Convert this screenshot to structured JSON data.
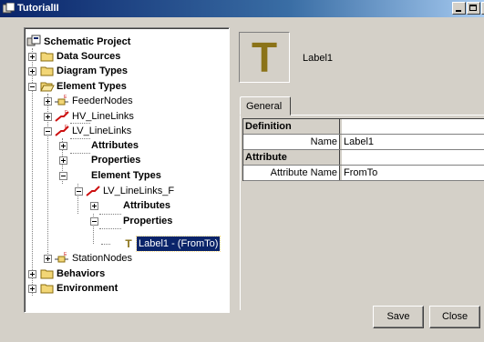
{
  "window": {
    "title": "TutorialII"
  },
  "tree": {
    "root": "Schematic Project",
    "data_sources": "Data Sources",
    "diagram_types": "Diagram Types",
    "element_types": "Element Types",
    "feeder_nodes": "FeederNodes",
    "hv_linelinks": "HV_LineLinks",
    "lv_linelinks": "LV_LineLinks",
    "attributes": "Attributes",
    "properties": "Properties",
    "element_types_nested": "Element Types",
    "lv_linelinks_f": "LV_LineLinks_F",
    "attributes_nested": "Attributes",
    "properties_nested": "Properties",
    "label1_item": "Label1 - (FromTo)",
    "station_nodes": "StationNodes",
    "behaviors": "Behaviors",
    "environment": "Environment"
  },
  "header": {
    "icon_letter": "T",
    "label": "Label1"
  },
  "tabs": [
    {
      "label": "General"
    }
  ],
  "props": {
    "definition": "Definition",
    "name_key": "Name",
    "name_value": "Label1",
    "attribute": "Attribute",
    "attrname_key": "Attribute Name",
    "attrname_value": "FromTo"
  },
  "buttons": {
    "save": "Save",
    "close": "Close"
  },
  "colors": {
    "title_start": "#0a246a",
    "title_end": "#a6caf0",
    "selection": "#0a246a",
    "folder": "#f2d676",
    "icon_letter": "#8b7318",
    "link_red": "#cc1010"
  }
}
